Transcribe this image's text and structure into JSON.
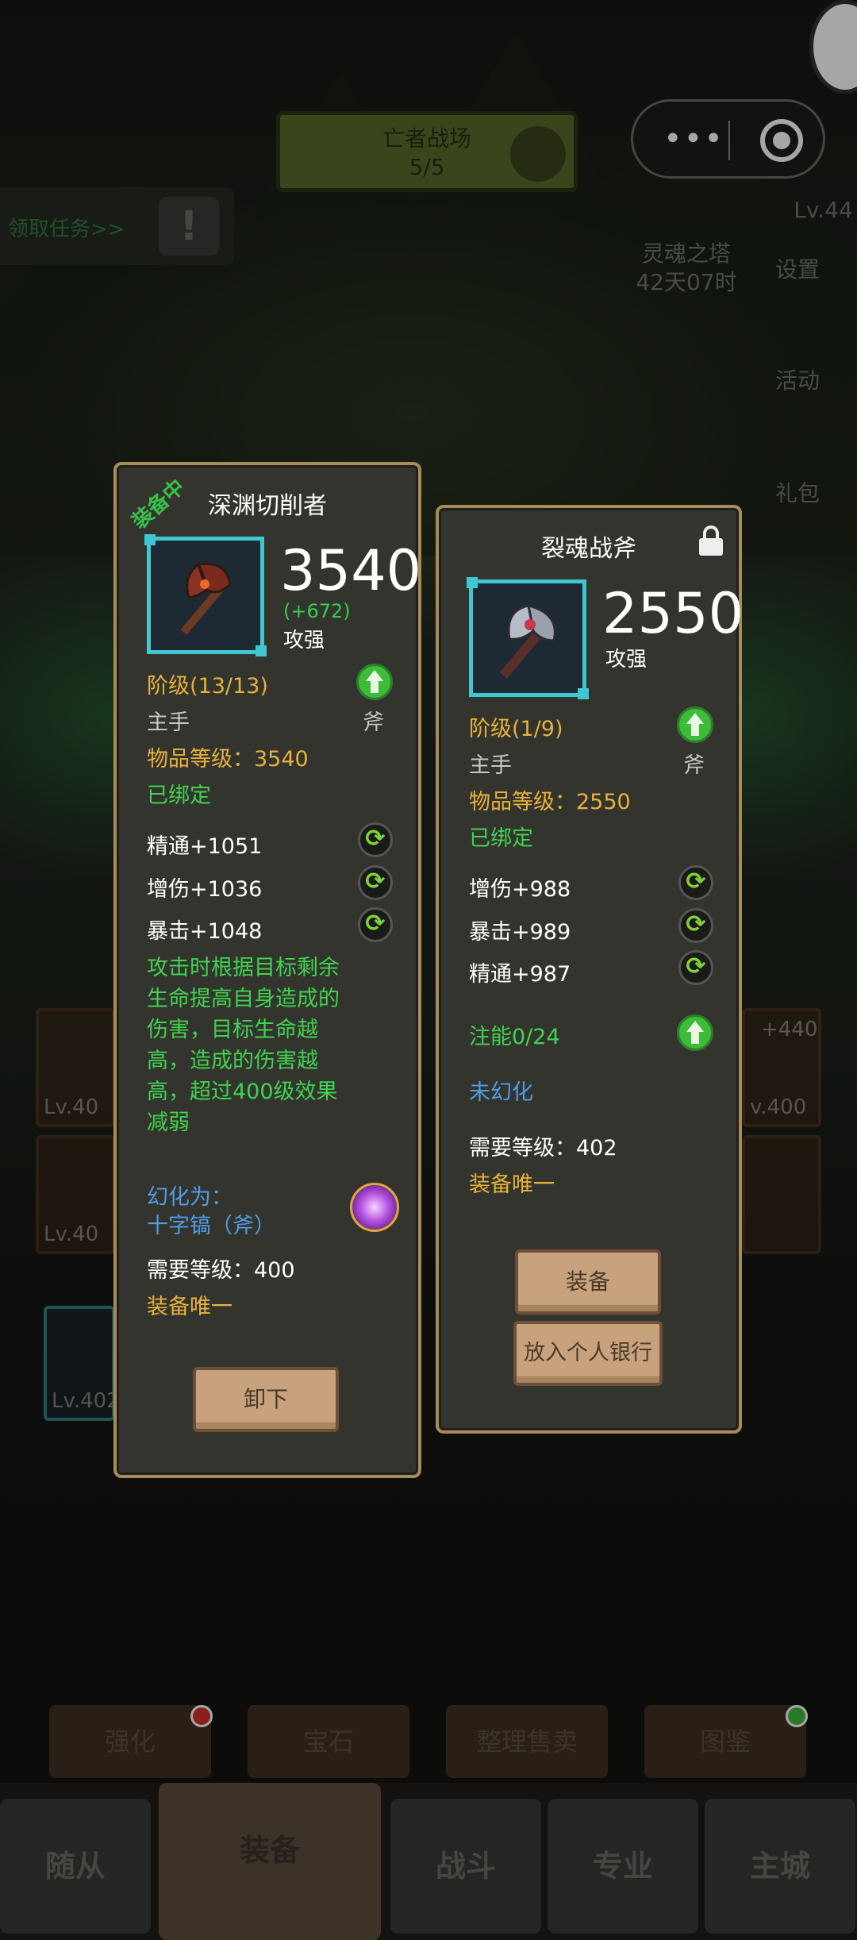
{
  "background": {
    "battlefield_banner": {
      "title": "亡者战场",
      "progress": "5/5"
    },
    "task_bar": {
      "label": "领取任务>>"
    },
    "tower": {
      "name": "灵魂之塔",
      "timer": "42天07时"
    },
    "player_level": "Lv.44",
    "side_menu": {
      "settings": "设置",
      "events": "活动",
      "gift": "礼包"
    },
    "slots": [
      "Lv.40",
      "Lv.40",
      "Lv.402",
      "+440",
      "v.400"
    ],
    "actions": [
      {
        "label": "强化",
        "badge": "red"
      },
      {
        "label": "宝石",
        "badge": ""
      },
      {
        "label": "整理售卖",
        "badge": ""
      },
      {
        "label": "图鉴",
        "badge": "green"
      }
    ],
    "nav": [
      {
        "label": "随从"
      },
      {
        "label": "装备",
        "active": true
      },
      {
        "label": "战斗"
      },
      {
        "label": "专业"
      },
      {
        "label": "主城"
      }
    ]
  },
  "equipped_item": {
    "status_tag": "装备中",
    "name": "深渊切削者",
    "icon": "axe-icon",
    "power": "3540",
    "power_bonus": "(+672)",
    "power_type": "攻强",
    "tier": "阶级(13/13)",
    "slot": "主手",
    "weapon_type": "斧",
    "item_level": "物品等级：3540",
    "bound": "已绑定",
    "stats": [
      "精通+1051",
      "增伤+1036",
      "暴击+1048"
    ],
    "effect": "攻击时根据目标剩余生命提高自身造成的伤害，目标生命越高，造成的伤害越高，超过400级效果减弱",
    "transmog_label": "幻化为：",
    "transmog_value": "十字镐（斧）",
    "required_level": "需要等级：400",
    "unique": "装备唯一",
    "button": "卸下"
  },
  "compare_item": {
    "name": "裂魂战斧",
    "icon": "axe-icon",
    "power": "2550",
    "power_type": "攻强",
    "tier": "阶级(1/9)",
    "slot": "主手",
    "weapon_type": "斧",
    "item_level": "物品等级：2550",
    "bound": "已绑定",
    "stats": [
      "增伤+988",
      "暴击+989",
      "精通+987"
    ],
    "infusion": "注能0/24",
    "transmog": "未幻化",
    "required_level": "需要等级：402",
    "unique": "装备唯一",
    "button_equip": "装备",
    "button_bank": "放入个人银行"
  },
  "colors": {
    "gold": "#e6b23a",
    "green": "#3fd34f",
    "frame": "#3fc8d2",
    "blue": "#4f9de6",
    "panel_border": "#a88b5a"
  }
}
